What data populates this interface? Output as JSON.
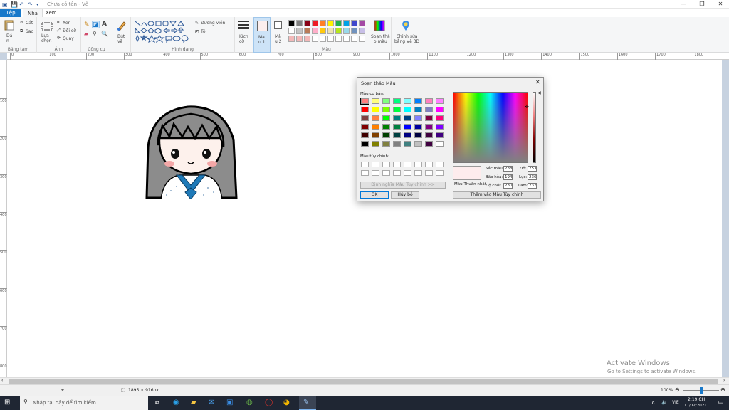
{
  "window": {
    "title": "Chưa có tên - Vẽ",
    "minimize": "—",
    "restore": "❐",
    "close": "✕"
  },
  "tabs": [
    "Tệp",
    "Nhà",
    "Xem"
  ],
  "ribbon": {
    "clipboard": {
      "label": "Bảng tạm",
      "paste": "Dá\nn",
      "cut": "Cắt",
      "copy": "Sao"
    },
    "image": {
      "label": "Ảnh",
      "select": "Lựa\nchọn",
      "crop": "Xén",
      "resize": "Đổi cỡ",
      "rotate": "Quay"
    },
    "tools": {
      "label": "Công cụ"
    },
    "brushes": {
      "label": "Bút\nvẽ"
    },
    "shapes": {
      "label": "Hình dạng",
      "outline": "Đường viền",
      "fill": "Tô"
    },
    "size": {
      "label": "Kích\ncỡ"
    },
    "color1": {
      "label": "Mà\nu 1"
    },
    "color2": {
      "label": "Mà\nu 2"
    },
    "colors": {
      "label": "Màu"
    },
    "edit_colors": {
      "label": "Soạn thả\no màu"
    },
    "paint3d": {
      "label": "Chỉnh sửa\nbằng Vẽ 3D"
    }
  },
  "palette": {
    "row1": [
      "#000000",
      "#7f7f7f",
      "#880015",
      "#ed1c24",
      "#ff7f27",
      "#fff200",
      "#22b14c",
      "#00a2e8",
      "#3f48cc",
      "#a349a4"
    ],
    "row2": [
      "#ffffff",
      "#c3c3c3",
      "#b97a57",
      "#ffaec9",
      "#ffc90e",
      "#efe4b0",
      "#b5e61d",
      "#99d9ea",
      "#7092be",
      "#c8bfe7"
    ],
    "row3": [
      "#f2b8b8",
      "#f2b8b8",
      "#f2b8b8",
      "#ffffff",
      "#ffffff",
      "#ffffff",
      "#ffffff",
      "#ffffff",
      "#ffffff",
      "#ffffff"
    ],
    "color1_value": "#fceeed",
    "color2_value": "#ffffff"
  },
  "ruler": {
    "h": [
      "0",
      "100",
      "200",
      "300",
      "400",
      "500",
      "600",
      "700",
      "800",
      "900",
      "1000",
      "1100",
      "1200",
      "1300",
      "1400",
      "1500",
      "1600",
      "1700",
      "1800"
    ],
    "v": [
      "100",
      "200",
      "300",
      "400",
      "500",
      "600",
      "700",
      "800"
    ]
  },
  "dialog": {
    "title": "Soạn thảo Màu",
    "basic_label": "Màu cơ bản:",
    "custom_label": "Màu tùy chỉnh:",
    "define_button": "Định nghĩa Màu Tùy chỉnh >>",
    "ok": "OK",
    "cancel": "Hủy bỏ",
    "add_button": "Thêm vào Màu Tùy chỉnh",
    "solid_label": "Màu|Thuần nhất",
    "hue_label": "Sắc màu:",
    "hue": "238",
    "sat_label": "Bão hòa:",
    "sat": "194",
    "lum_label": "Độ chói:",
    "lum": "230",
    "red_label": "Đỏ:",
    "red": "253",
    "green_label": "Lục:",
    "green": "236",
    "blue_label": "Lam:",
    "blue": "237",
    "preview_color": "#fdeced",
    "basic_colors": [
      "#ff8080",
      "#ffff80",
      "#80ff80",
      "#00ff80",
      "#80ffff",
      "#0080ff",
      "#ff80c0",
      "#ff80ff",
      "#ff0000",
      "#ffff00",
      "#80ff00",
      "#00ff40",
      "#00ffff",
      "#0080c0",
      "#8080c0",
      "#ff00ff",
      "#804040",
      "#ff8040",
      "#00ff00",
      "#008080",
      "#004080",
      "#8080ff",
      "#800040",
      "#ff0080",
      "#800000",
      "#ff8000",
      "#008000",
      "#008040",
      "#0000ff",
      "#0000a0",
      "#800080",
      "#8000ff",
      "#400000",
      "#804000",
      "#004000",
      "#004040",
      "#000080",
      "#000040",
      "#400040",
      "#400080",
      "#000000",
      "#808000",
      "#808040",
      "#808080",
      "#408080",
      "#c0c0c0",
      "#400040",
      "#ffffff"
    ]
  },
  "status": {
    "dimensions": "1895 × 916px",
    "zoom": "100%"
  },
  "watermark": {
    "line1": "Activate Windows",
    "line2": "Go to Settings to activate Windows."
  },
  "taskbar": {
    "search_placeholder": "Nhập tại đây để tìm kiếm",
    "lang": "VIE",
    "time": "2:19 CH",
    "date": "11/02/2021"
  }
}
